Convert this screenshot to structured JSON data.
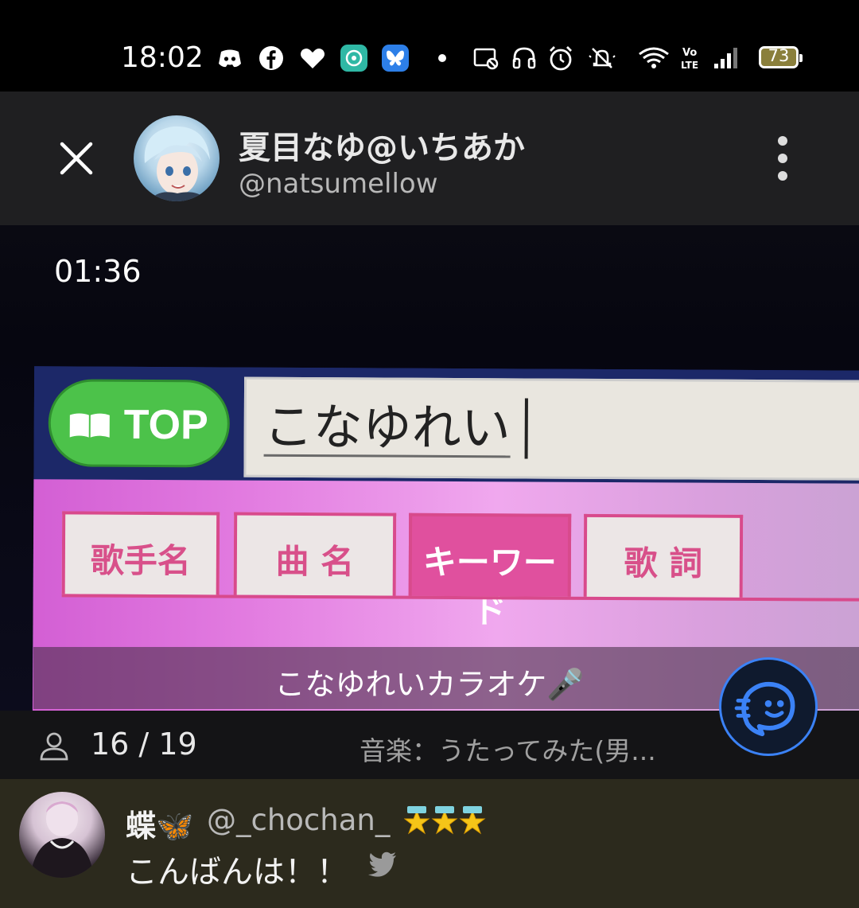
{
  "status_bar": {
    "time": "18:02",
    "battery": "73",
    "icons": [
      "discord-icon",
      "facebook-icon",
      "heart-icon",
      "teal-app-icon",
      "bluesky-icon",
      "dot-icon",
      "cast-icon",
      "headset-icon",
      "alarm-icon",
      "mute-icon",
      "wifi-icon",
      "volte-icon",
      "signal-icon",
      "battery-icon"
    ],
    "volte_label": "Vo\nLTE"
  },
  "header": {
    "display_name": "夏目なゆ@いちあか",
    "handle": "@natsumellow"
  },
  "video": {
    "timer": "01:36",
    "top_button": "TOP",
    "search_text": "こなゆれい",
    "tabs": [
      {
        "label": "歌手名"
      },
      {
        "label": "曲 名"
      },
      {
        "label": "キーワード",
        "active": true
      },
      {
        "label": "歌 詞"
      }
    ],
    "caption": "こなゆれいカラオケ🎤"
  },
  "info": {
    "viewers": "16 / 19",
    "music": "音楽：うたってみた(男..."
  },
  "comment": {
    "name": "蝶🦋",
    "handle": "@_chochan_",
    "text": "こんばんは！！"
  },
  "colors": {
    "accent_blue": "#3b82f6",
    "top_green": "#4cc24a",
    "tab_pink": "#d84a8c",
    "header_bg": "#1f1f21",
    "comment_bg": "#2c2a1d"
  }
}
